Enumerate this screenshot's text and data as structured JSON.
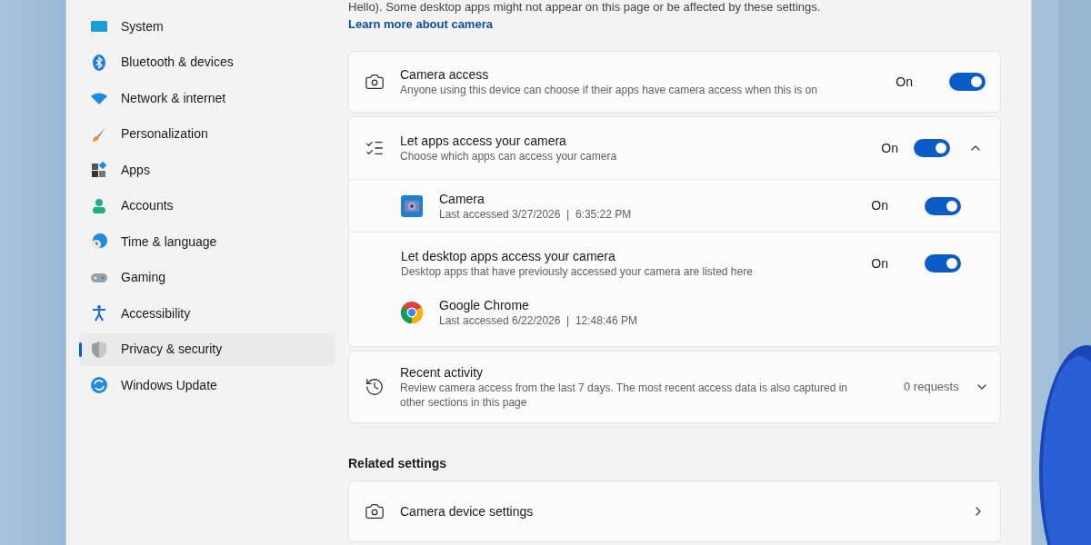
{
  "sidebar": {
    "items": [
      {
        "label": "System",
        "selected": false
      },
      {
        "label": "Bluetooth & devices",
        "selected": false
      },
      {
        "label": "Network & internet",
        "selected": false
      },
      {
        "label": "Personalization",
        "selected": false
      },
      {
        "label": "Apps",
        "selected": false
      },
      {
        "label": "Accounts",
        "selected": false
      },
      {
        "label": "Time & language",
        "selected": false
      },
      {
        "label": "Gaming",
        "selected": false
      },
      {
        "label": "Accessibility",
        "selected": false
      },
      {
        "label": "Privacy & security",
        "selected": true
      },
      {
        "label": "Windows Update",
        "selected": false
      }
    ]
  },
  "intro": {
    "text": "Hello). Some desktop apps might not appear on this page or be affected by these settings.",
    "link": "Learn more about camera"
  },
  "cards": [
    {
      "kind": "toggle",
      "title": "Camera access",
      "subtitle": "Anyone using this device can choose if their apps have camera access when this is on",
      "state_label": "On",
      "on": true
    },
    {
      "kind": "group",
      "title": "Let apps access your camera",
      "subtitle": "Choose which apps can access your camera",
      "state_label": "On",
      "on": true,
      "expanded": true,
      "items": [
        {
          "kind": "app",
          "title": "Camera",
          "subtitle": "Last accessed 3/27/2026  |  6:35:22 PM",
          "state_label": "On",
          "on": true
        },
        {
          "kind": "desktop",
          "title": "Let desktop apps access your camera",
          "subtitle": "Desktop apps that have previously accessed your camera are listed here",
          "state_label": "On",
          "on": true,
          "apps": [
            {
              "title": "Google Chrome",
              "subtitle": "Last accessed 6/22/2026  |  12:48:46 PM"
            }
          ]
        }
      ]
    },
    {
      "kind": "expander",
      "title": "Recent activity",
      "subtitle": "Review camera access from the last 7 days. The most recent access data is also captured in other sections in this page",
      "value": "0 requests",
      "expanded": false
    }
  ],
  "related": {
    "heading": "Related settings",
    "items": [
      {
        "title": "Camera device settings"
      }
    ]
  }
}
